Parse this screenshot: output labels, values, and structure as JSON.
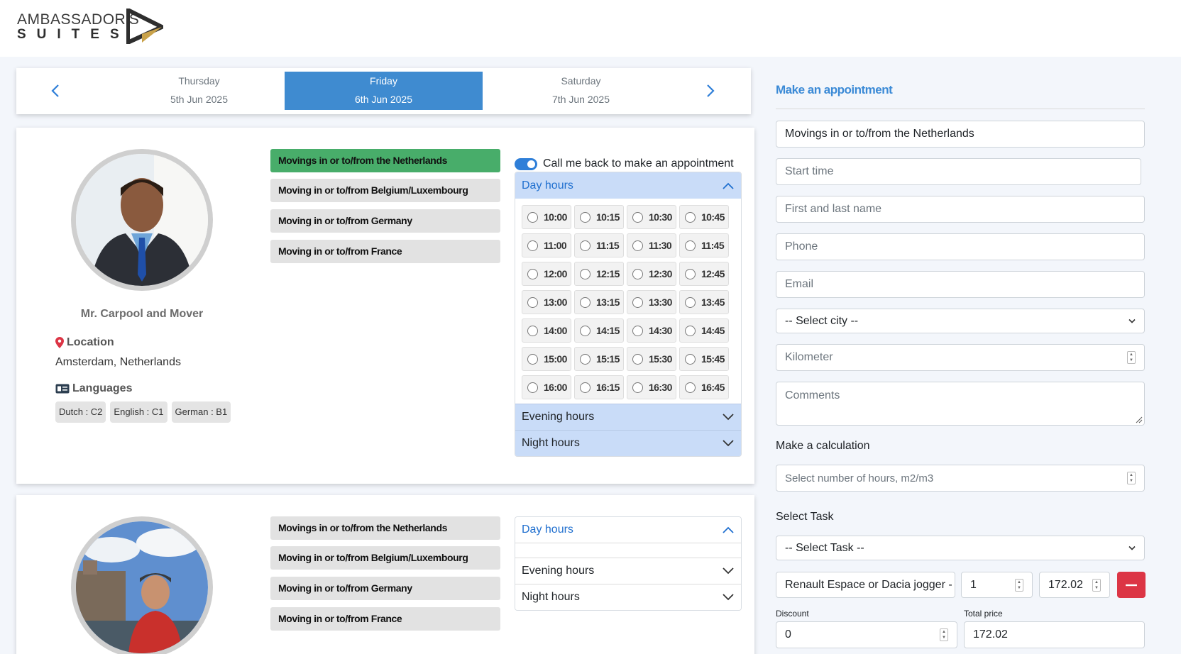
{
  "brand": {
    "line1": "AMBASSADOR'S",
    "line2": "SUITES"
  },
  "dates": {
    "prev_icon": "chevron-left-icon",
    "next_icon": "chevron-right-icon",
    "days": [
      {
        "weekday": "Thursday",
        "date": "5th Jun 2025"
      },
      {
        "weekday": "Friday",
        "date": "6th Jun 2025",
        "selected": true
      },
      {
        "weekday": "Saturday",
        "date": "7th Jun 2025"
      }
    ]
  },
  "provider1": {
    "name": "Mr. Carpool and Mover",
    "location_label": "Location",
    "location": "Amsterdam, Netherlands",
    "languages_label": "Languages",
    "languages": [
      "Dutch : C2",
      "English : C1",
      "German : B1"
    ],
    "services": [
      "Movings in or to/from the Netherlands",
      "Moving in or to/from Belgium/Luxembourg",
      "Moving in or to/from Germany",
      "Moving in or to/from France"
    ],
    "callback_label": "Call me back to make an appointment",
    "day_hours_label": "Day hours",
    "evening_hours_label": "Evening hours",
    "night_hours_label": "Night hours",
    "slots": [
      "10:00",
      "10:15",
      "10:30",
      "10:45",
      "11:00",
      "11:15",
      "11:30",
      "11:45",
      "12:00",
      "12:15",
      "12:30",
      "12:45",
      "13:00",
      "13:15",
      "13:30",
      "13:45",
      "14:00",
      "14:15",
      "14:30",
      "14:45",
      "15:00",
      "15:15",
      "15:30",
      "15:45",
      "16:00",
      "16:15",
      "16:30",
      "16:45"
    ]
  },
  "provider2": {
    "services": [
      "Movings in or to/from the Netherlands",
      "Moving in or to/from Belgium/Luxembourg",
      "Moving in or to/from Germany",
      "Moving in or to/from France"
    ],
    "day_hours_label": "Day hours",
    "evening_hours_label": "Evening hours",
    "night_hours_label": "Night hours"
  },
  "form": {
    "title": "Make an appointment",
    "service_value": "Movings in or to/from the Netherlands",
    "start_time_placeholder": "Start time",
    "name_placeholder": "First and last name",
    "phone_placeholder": "Phone",
    "email_placeholder": "Email",
    "city_select": "-- Select city --",
    "km_placeholder": "Kilometer",
    "comments_placeholder": "Comments",
    "calc_label": "Make a calculation",
    "hours_placeholder": "Select number of hours, m2/m3",
    "task_label": "Select Task",
    "task_select": "-- Select Task --",
    "task_item": "Renault Espace or Dacia jogger -",
    "task_qty": "1",
    "task_price": "172.02",
    "discount_label": "Discount",
    "discount_value": "0",
    "total_label": "Total price",
    "total_value": "172.02",
    "accent": "#3b8ad6",
    "danger": "#dc3545"
  }
}
